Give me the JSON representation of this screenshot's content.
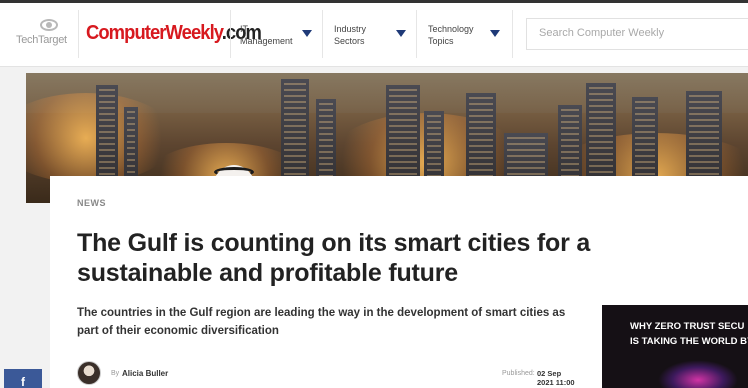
{
  "header": {
    "techtarget_logo": "TechTarget",
    "brand_logo_main": "ComputerWeekly",
    "brand_logo_suffix": ".com",
    "nav": [
      {
        "label_line1": "IT",
        "label_line2": "Management",
        "icon": "chevron-down-icon"
      },
      {
        "label_line1": "Industry",
        "label_line2": "Sectors",
        "icon": "chevron-down-icon"
      },
      {
        "label_line1": "Technology",
        "label_line2": "Topics",
        "icon": "chevron-down-icon"
      }
    ],
    "search": {
      "placeholder": "Search Computer Weekly",
      "value": ""
    }
  },
  "article": {
    "kicker": "NEWS",
    "title": "The Gulf is counting on its smart cities for a sustainable and profitable future",
    "summary": "The countries in the Gulf region are leading the way in the development of smart cities as part of their economic diversification",
    "by_label": "By",
    "author": "Alicia Buller",
    "published_label": "Published:",
    "published_date": "02 Sep 2021 11:00"
  },
  "ad": {
    "line1": "WHY ZERO TRUST SECU",
    "line2": "IS TAKING THE WORLD BY"
  },
  "social": {
    "facebook_icon_label": "f"
  },
  "colors": {
    "brand_red": "#d7191f",
    "nav_arrow": "#1f3a78",
    "facebook_blue": "#3b5998"
  }
}
